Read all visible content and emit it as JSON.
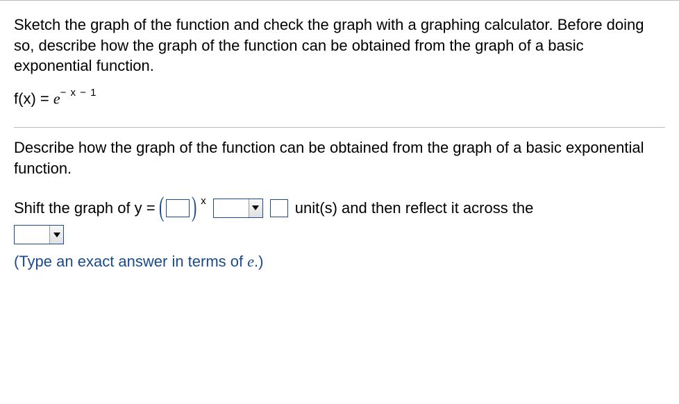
{
  "question": {
    "intro": "Sketch the graph of the function and check the graph with a graphing calculator. Before doing so, describe how the graph of the function can be obtained from the graph of a basic exponential function.",
    "fx_label": "f(x) = ",
    "exponent": "− x − 1"
  },
  "prompt": "Describe how the graph of the function can be obtained from the graph of a basic exponential function.",
  "answer": {
    "prefix": "Shift the graph of y = ",
    "exp_var": "x",
    "mid1": "unit(s) and then reflect it across the"
  },
  "hint": {
    "open": "(Type an exact answer in terms of ",
    "close": ".)"
  }
}
